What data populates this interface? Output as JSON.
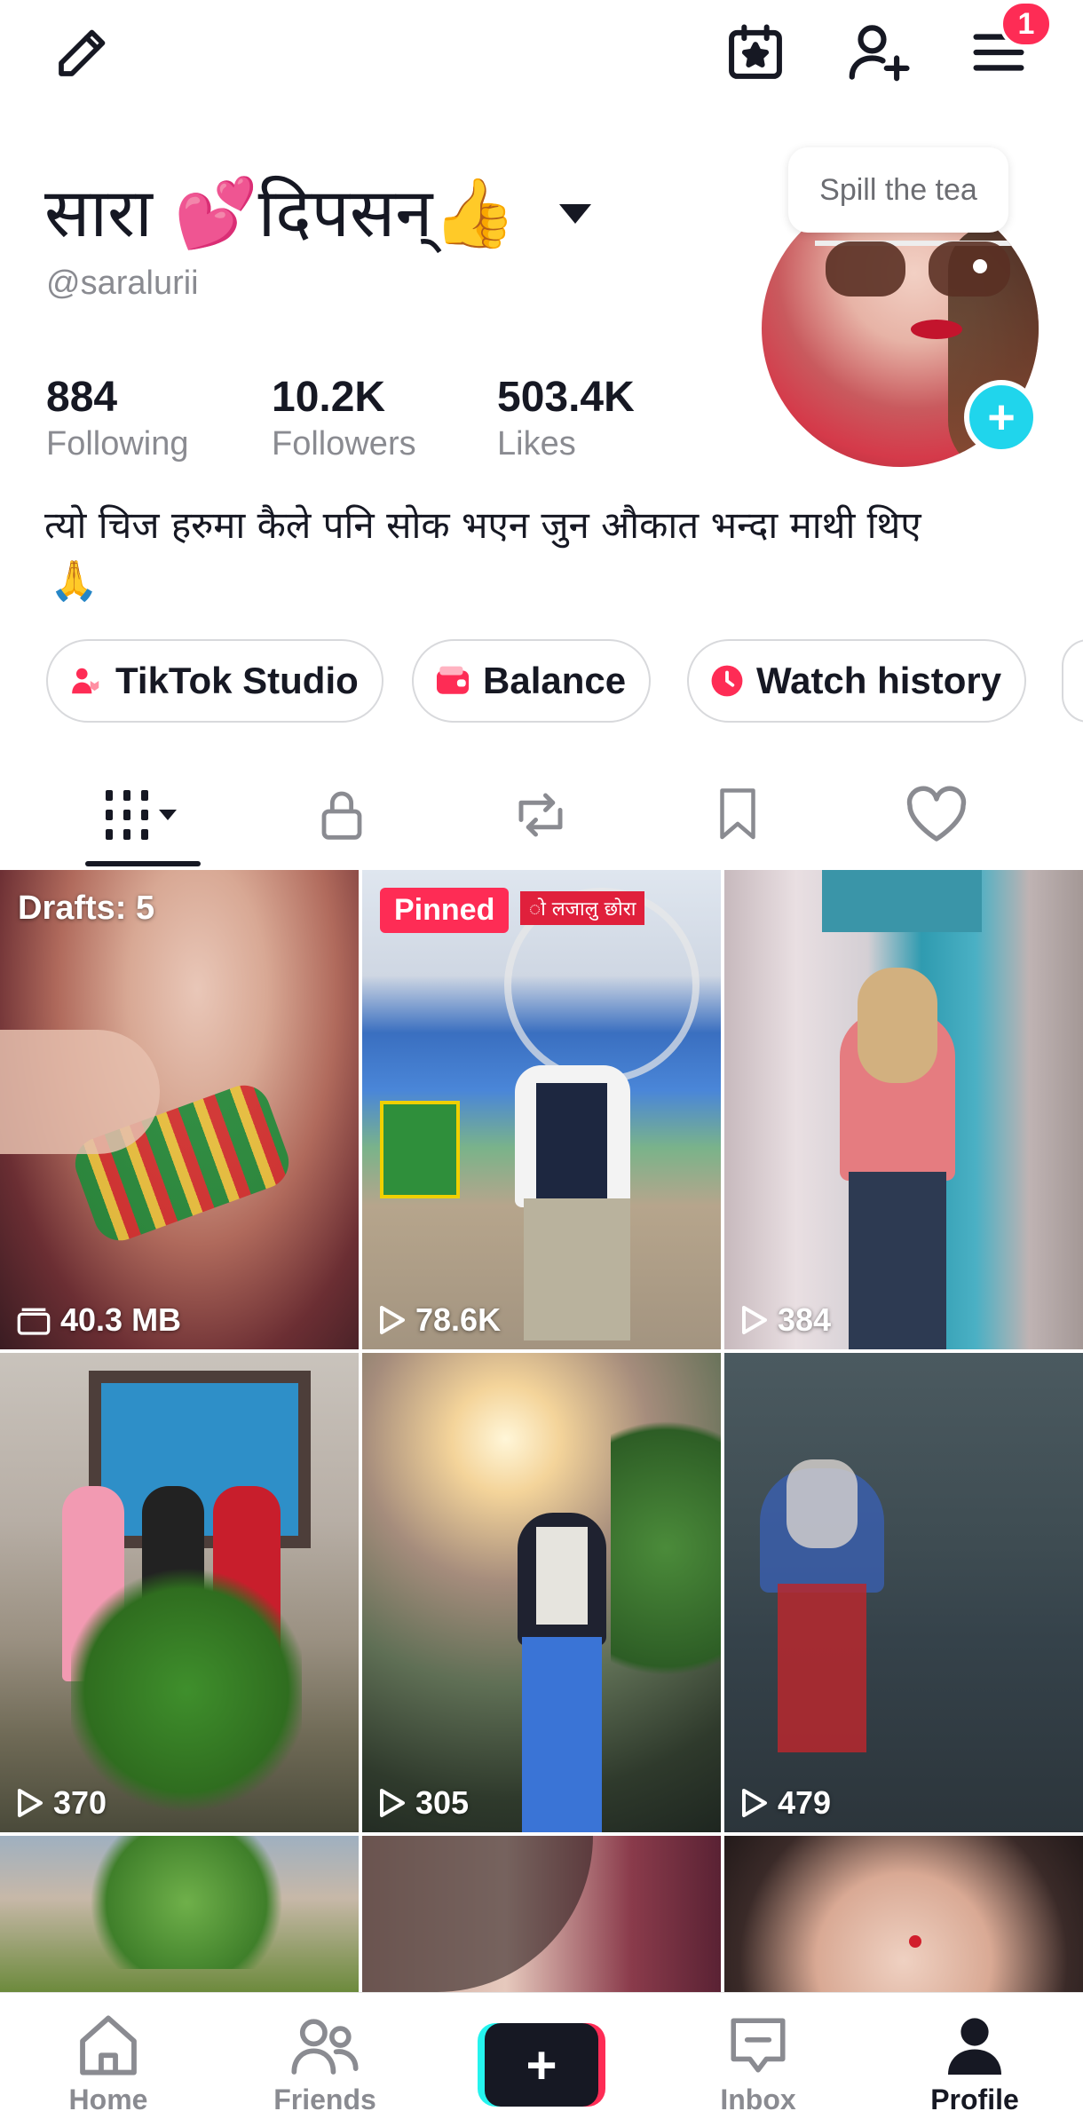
{
  "header": {
    "notification_count": "1"
  },
  "profile": {
    "display_name": "सारा 💕दिपसन्👍",
    "handle": "@saralurii",
    "avatar_bubble": "Spill the tea",
    "bio": "त्यो चिज हरुमा कैले पनि सोक भएन जुन औकात भन्दा माथी थिए",
    "bio_emoji": "🙏",
    "stats": [
      {
        "value": "884",
        "label": "Following"
      },
      {
        "value": "10.2K",
        "label": "Followers"
      },
      {
        "value": "503.4K",
        "label": "Likes"
      }
    ]
  },
  "chips": [
    {
      "label": "TikTok Studio",
      "icon": "studio-icon"
    },
    {
      "label": "Balance",
      "icon": "wallet-icon"
    },
    {
      "label": "Watch history",
      "icon": "clock-icon"
    }
  ],
  "tabs": [
    "videos-grid-icon",
    "lock-icon",
    "repost-icon",
    "bookmark-icon",
    "heart-icon"
  ],
  "grid": {
    "drafts_label": "Drafts: 5",
    "pinned_label": "Pinned",
    "pinned_caption": "ो लजालु छोरा",
    "tiles": [
      {
        "stat": "40.3 MB",
        "icon": "drafts-icon"
      },
      {
        "stat": "78.6K",
        "icon": "play-icon"
      },
      {
        "stat": "384",
        "icon": "play-icon"
      },
      {
        "stat": "370",
        "icon": "play-icon"
      },
      {
        "stat": "305",
        "icon": "play-icon"
      },
      {
        "stat": "479",
        "icon": "play-icon"
      }
    ]
  },
  "bottom_nav": [
    {
      "label": "Home",
      "icon": "home-icon"
    },
    {
      "label": "Friends",
      "icon": "friends-icon"
    },
    {
      "label": "",
      "icon": "create-icon"
    },
    {
      "label": "Inbox",
      "icon": "inbox-icon"
    },
    {
      "label": "Profile",
      "icon": "profile-icon"
    }
  ],
  "colors": {
    "accent": "#fe2c55",
    "cyan": "#20d5ec",
    "text": "#161823",
    "muted": "#8a8b91"
  }
}
